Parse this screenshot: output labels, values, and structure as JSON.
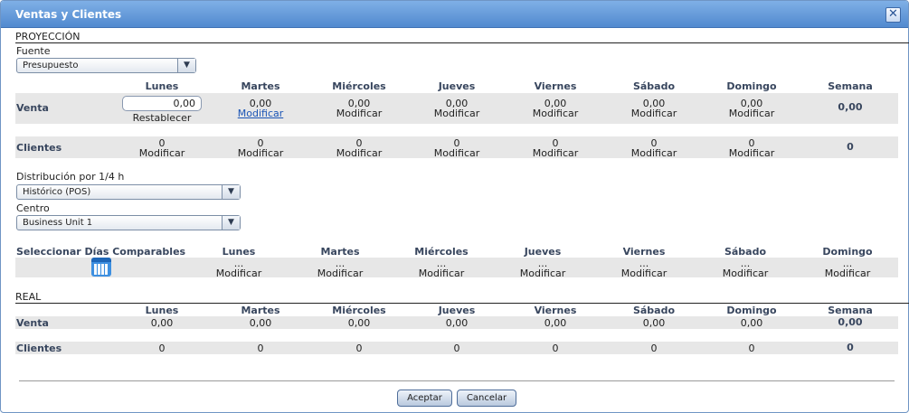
{
  "window": {
    "title": "Ventas y Clientes",
    "close_glyph": "✕"
  },
  "proyeccion": {
    "title": "PROYECCIÓN",
    "fuente_label": "Fuente",
    "fuente_value": "Presupuesto",
    "days": [
      "Lunes",
      "Martes",
      "Miércoles",
      "Jueves",
      "Viernes",
      "Sábado",
      "Domingo"
    ],
    "week_label": "Semana",
    "venta": {
      "label": "Venta",
      "input_value": "0,00",
      "restablecer": "Restablecer",
      "values": [
        "0,00",
        "0,00",
        "0,00",
        "0,00",
        "0,00",
        "0,00"
      ],
      "modificar": "Modificar",
      "week_total": "0,00"
    },
    "clientes": {
      "label": "Clientes",
      "values": [
        "0",
        "0",
        "0",
        "0",
        "0",
        "0",
        "0"
      ],
      "modificar": "Modificar",
      "week_total": "0"
    },
    "distribucion_label": "Distribución por 1/4 h",
    "distribucion_value": "Histórico (POS)",
    "centro_label": "Centro",
    "centro_value": "Business Unit 1"
  },
  "comparables": {
    "label": "Seleccionar Días Comparables",
    "days": [
      "Lunes",
      "Martes",
      "Miércoles",
      "Jueves",
      "Viernes",
      "Sábado",
      "Domingo"
    ],
    "dots": "...",
    "modificar": "Modificar",
    "calendar_icon": "calendar-icon"
  },
  "real": {
    "title": "REAL",
    "days": [
      "Lunes",
      "Martes",
      "Miércoles",
      "Jueves",
      "Viernes",
      "Sábado",
      "Domingo"
    ],
    "week_label": "Semana",
    "venta": {
      "label": "Venta",
      "values": [
        "0,00",
        "0,00",
        "0,00",
        "0,00",
        "0,00",
        "0,00",
        "0,00"
      ],
      "week_total": "0,00"
    },
    "clientes": {
      "label": "Clientes",
      "values": [
        "0",
        "0",
        "0",
        "0",
        "0",
        "0",
        "0"
      ],
      "week_total": "0"
    }
  },
  "buttons": {
    "accept": "Aceptar",
    "cancel": "Cancelar"
  },
  "colors": {
    "titlebar": "#5a92d6",
    "header_text": "#38465e",
    "band": "#e7e7e7",
    "link": "#1a54b5"
  }
}
